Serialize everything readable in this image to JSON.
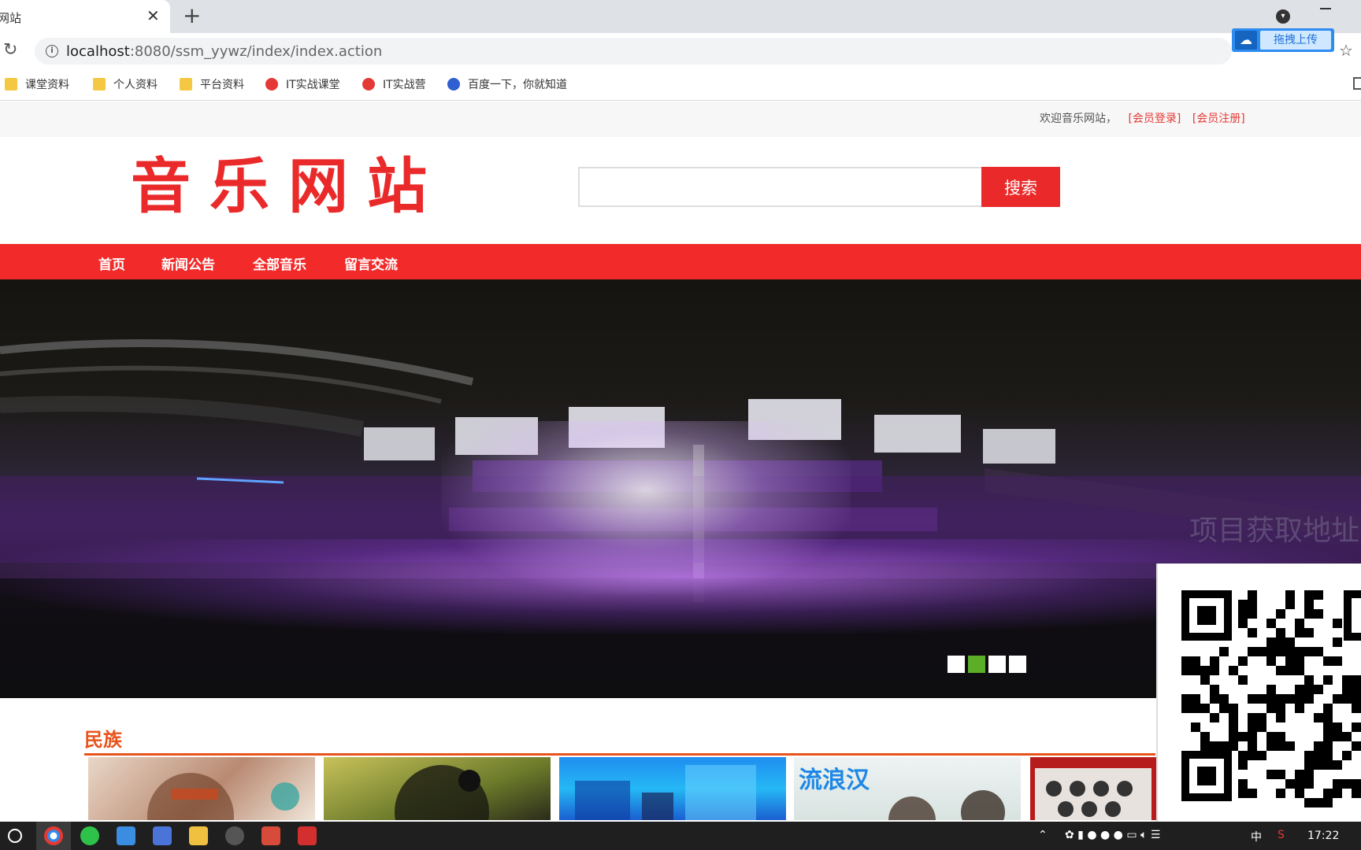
{
  "browser": {
    "tab_title": "网站",
    "url_host": "localhost",
    "url_path": ":8080/ssm_yywz/index/index.action",
    "extension_label": "拖拽上传",
    "bookmarks": [
      "课堂资料",
      "个人资料",
      "平台资料",
      "IT实战课堂",
      "IT实战营",
      "百度一下，你就知道"
    ]
  },
  "header": {
    "welcome": "欢迎音乐网站，",
    "login_link": "[会员登录]",
    "register_link": "[会员注册]",
    "logo": "音乐网站",
    "search_button": "搜索"
  },
  "nav": {
    "items": [
      "首页",
      "新闻公告",
      "全部音乐",
      "留言交流"
    ]
  },
  "banner": {
    "watermark": "项目获取地址",
    "slide_count": 4,
    "active_slide": 2
  },
  "section": {
    "title": "民族",
    "album_text": "流浪汉"
  },
  "taskbar": {
    "time": "17:22",
    "ime": "中"
  },
  "colors": {
    "brand_red": "#f22a2a",
    "section_orange": "#e8531c",
    "active_dot": "#5cae26"
  }
}
